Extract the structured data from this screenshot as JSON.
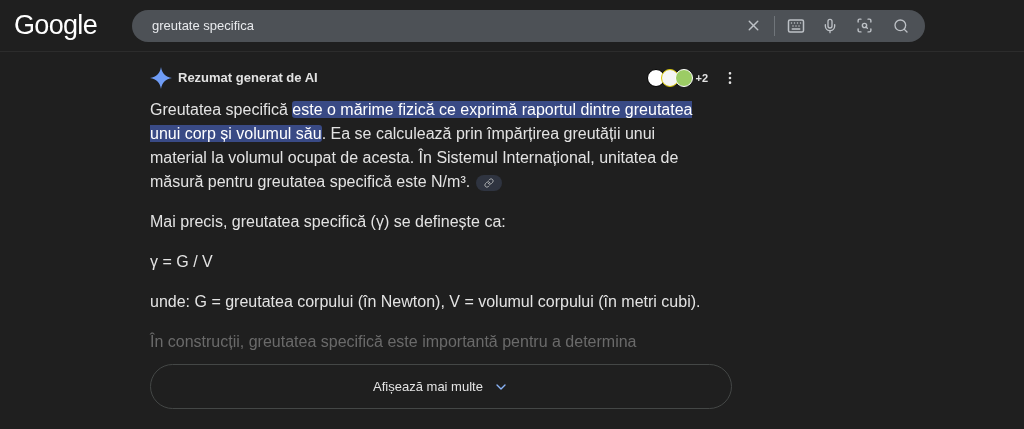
{
  "header": {
    "logo": "Google",
    "search": {
      "value": "greutate specifica"
    }
  },
  "ai_overview": {
    "title": "Rezumat generat de AI",
    "sources": {
      "count": "+2"
    },
    "paragraphs": [
      {
        "kind": "segments",
        "segments": [
          {
            "text": "Greutatea specifică ",
            "highlighted": false
          },
          {
            "text": "este o mărime fizică ce exprimă raportul dintre greutatea unui corp și volumul său",
            "highlighted": true
          },
          {
            "text": ". Ea se calculează prin împărțirea greutății unui material la volumul ocupat de acesta. În Sistemul Internațional, unitatea de măsură pentru greutatea specifică este N/m³.",
            "highlighted": false
          }
        ],
        "link_chip": true
      },
      {
        "kind": "text",
        "text": "Mai precis, greutatea specifică (γ) se definește ca:"
      },
      {
        "kind": "text",
        "text": "γ = G / V"
      },
      {
        "kind": "text",
        "text": "unde: G = greutatea corpului (în Newton), V = volumul corpului (în metri cubi)."
      },
      {
        "kind": "faded",
        "text": "În construcții, greutatea specifică este importantă pentru a determina"
      }
    ],
    "show_more": "Afișează mai multe"
  }
}
